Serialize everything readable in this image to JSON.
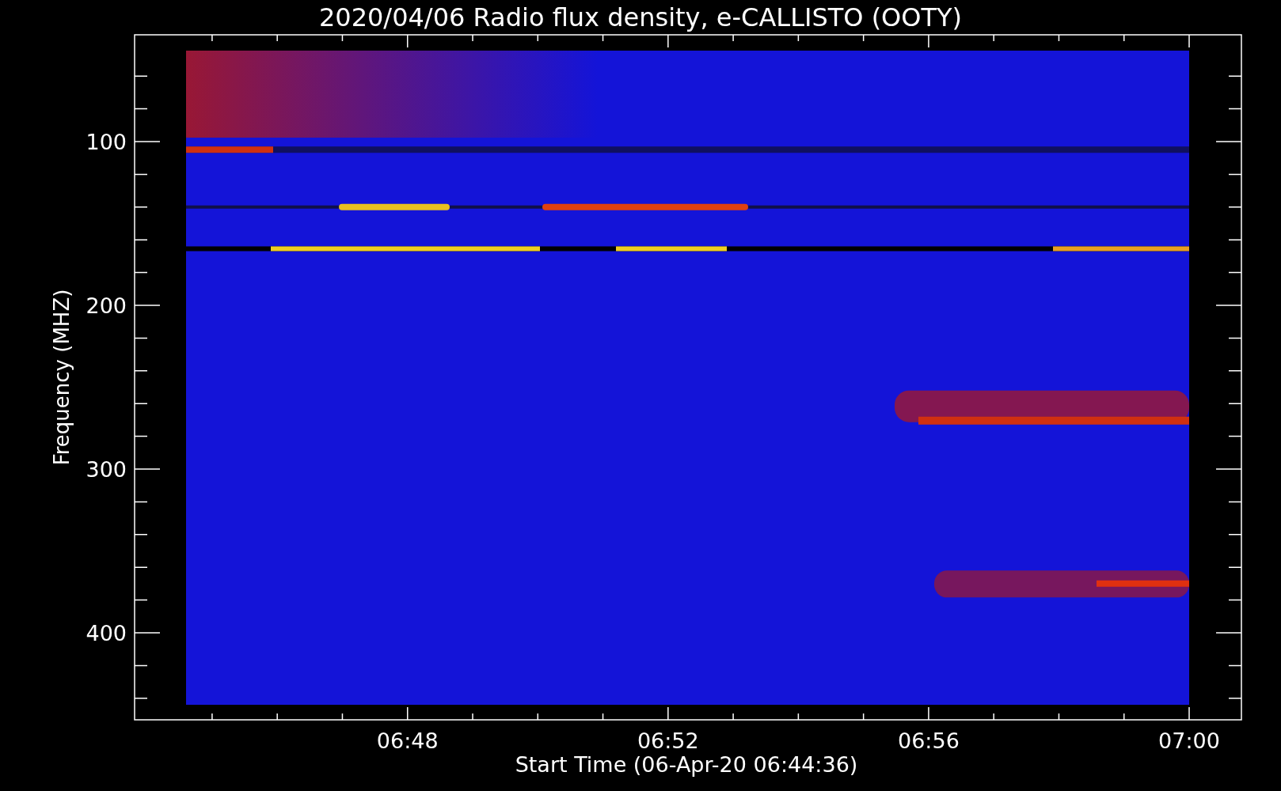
{
  "title": "2020/04/06  Radio flux density, e-CALLISTO (OOTY)",
  "y_axis": {
    "label": "Frequency (MHZ)",
    "ticks": [
      "100",
      "200",
      "300",
      "400"
    ]
  },
  "x_axis": {
    "label": "Start Time (06-Apr-20 06:44:36)",
    "ticks": [
      "06:48",
      "06:52",
      "06:56",
      "07:00"
    ]
  }
}
